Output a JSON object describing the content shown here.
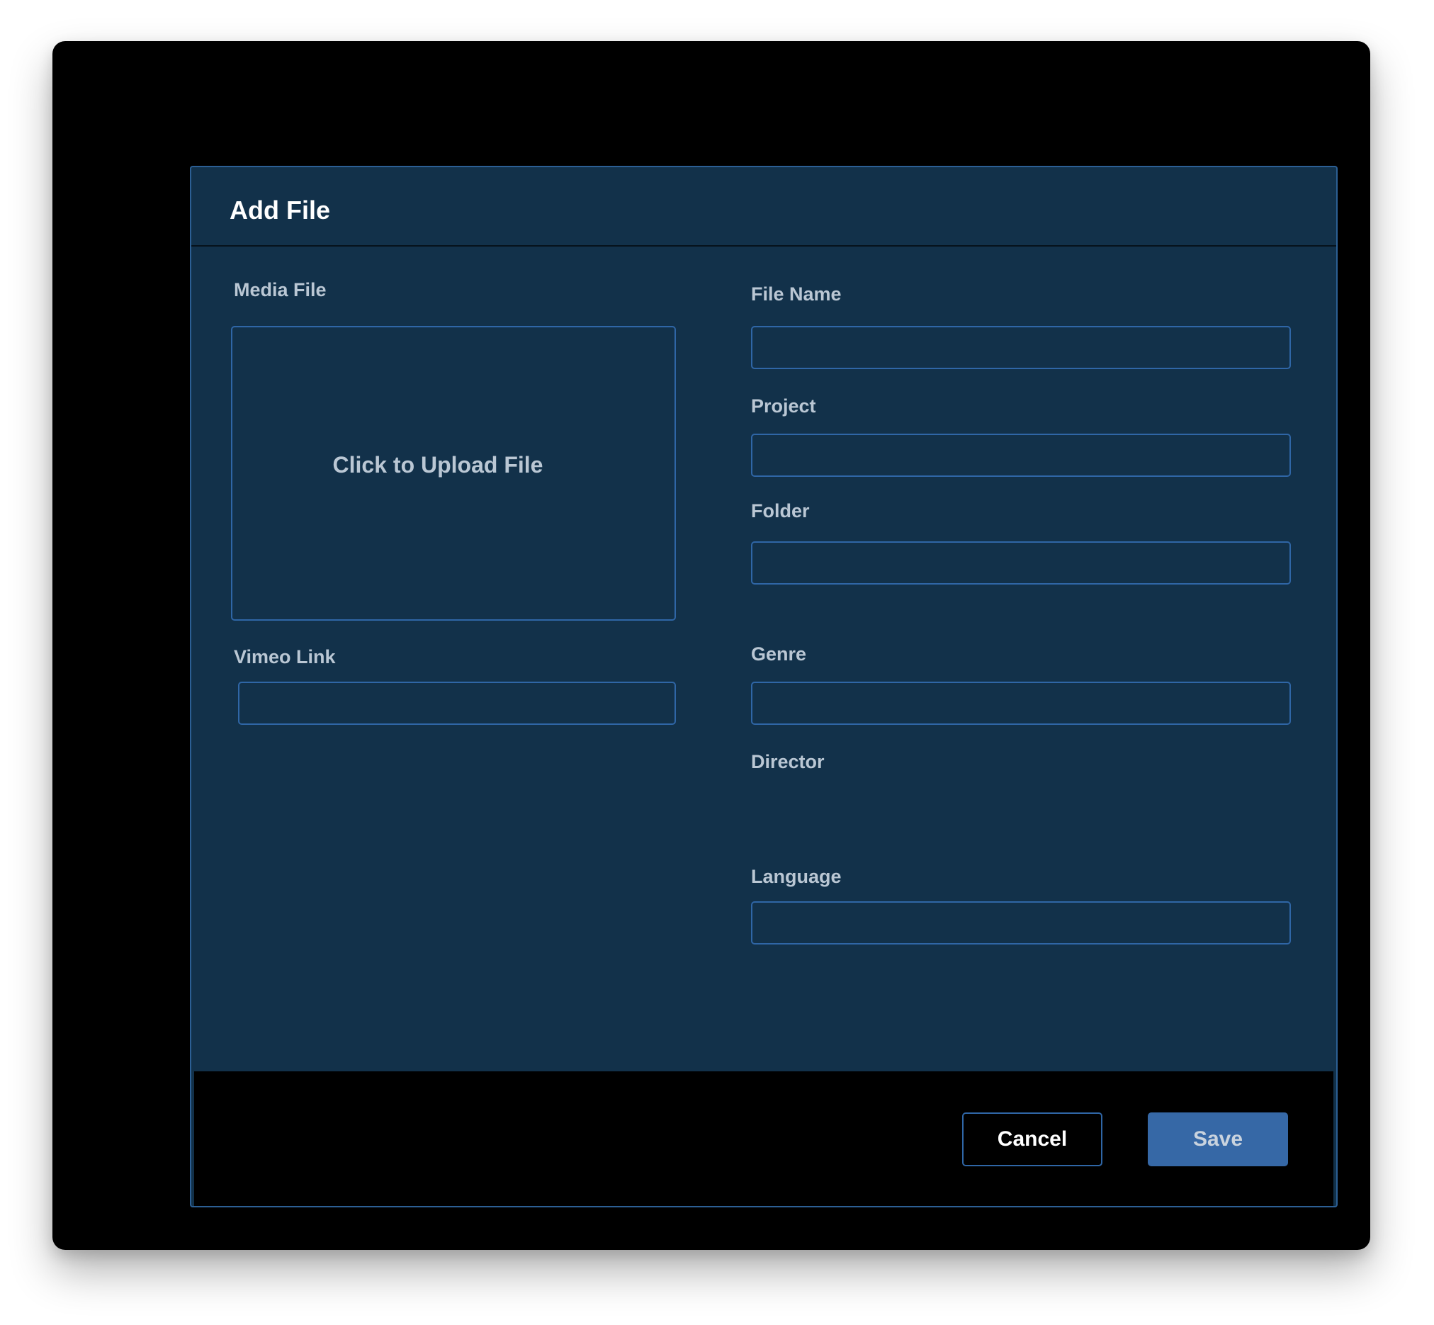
{
  "modal": {
    "title": "Add File"
  },
  "left": {
    "media_file_label": "Media File",
    "upload_text": "Click to Upload File",
    "vimeo_label": "Vimeo Link",
    "vimeo_value": ""
  },
  "right": {
    "file_name_label": "File Name",
    "file_name_value": "",
    "project_label": "Project",
    "project_value": "",
    "folder_label": "Folder",
    "folder_value": "",
    "genre_label": "Genre",
    "genre_value": "",
    "director_label": "Director",
    "language_label": "Language",
    "language_value": ""
  },
  "footer": {
    "cancel_label": "Cancel",
    "save_label": "Save"
  },
  "colors": {
    "window_bg": "#000000",
    "modal_bg": "#12314a",
    "border_accent": "#2f66a6",
    "label_text": "#bac7d4",
    "save_button": "#3668a6"
  }
}
